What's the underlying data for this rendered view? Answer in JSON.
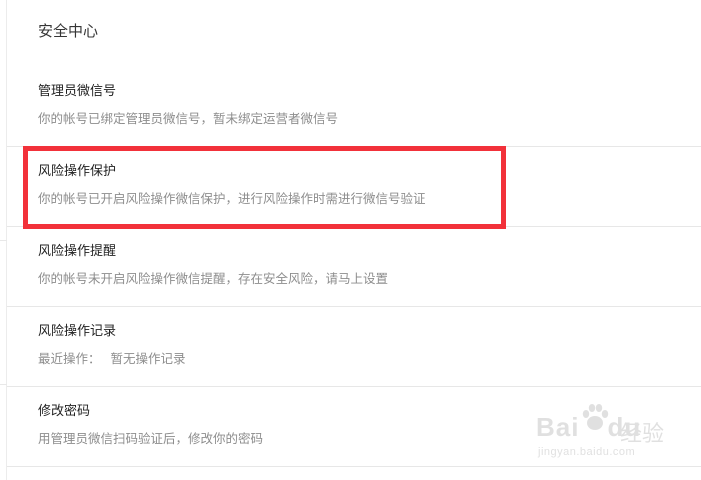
{
  "page": {
    "title": "安全中心"
  },
  "sections": [
    {
      "title": "管理员微信号",
      "desc": "你的帐号已绑定管理员微信号，暂未绑定运营者微信号"
    },
    {
      "title": "风险操作保护",
      "desc": "你的帐号已开启风险操作微信保护，进行风险操作时需进行微信号验证"
    },
    {
      "title": "风险操作提醒",
      "desc": "你的帐号未开启风险操作微信提醒，存在安全风险，请马上设置"
    },
    {
      "title": "风险操作记录",
      "desc_label": "最近操作：",
      "desc_value": "暂无操作记录"
    },
    {
      "title": "修改密码",
      "desc": "用管理员微信扫码验证后，修改你的密码"
    }
  ],
  "highlight": {
    "color": "#f2313a",
    "target": "风险操作保护"
  },
  "watermark": {
    "logo_text": "Bai",
    "logo_text_2": "du",
    "brand_cn": "经验",
    "url": "jingyan.baidu.com"
  }
}
